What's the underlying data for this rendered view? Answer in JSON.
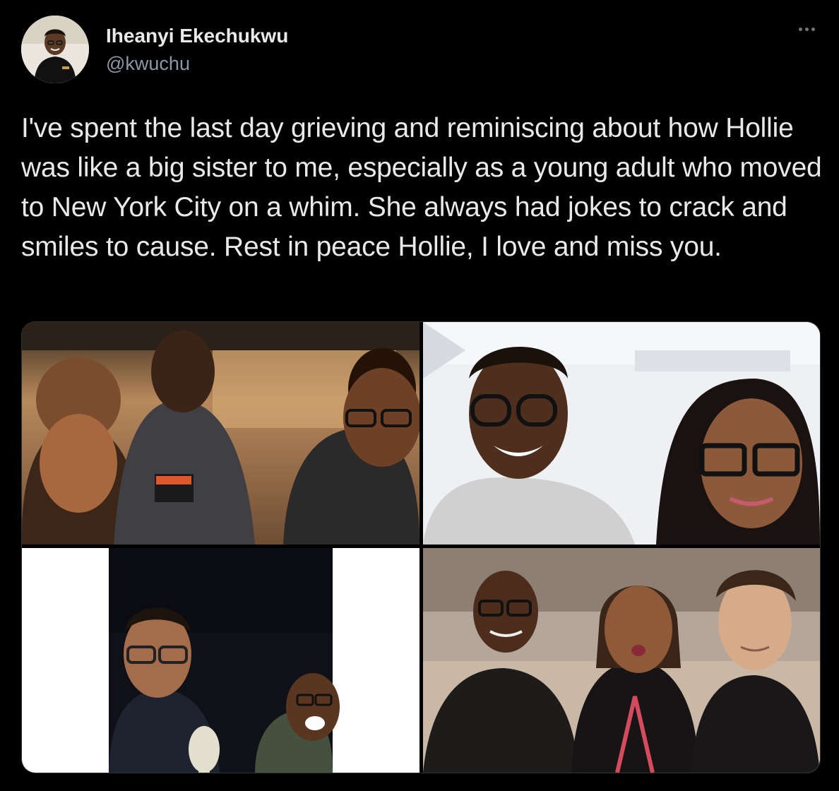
{
  "tweet": {
    "author": {
      "display_name": "Iheanyi Ekechukwu",
      "handle": "@kwuchu"
    },
    "more_icon": "ellipsis-icon",
    "text": "I've spent the last day grieving and reminiscing about how Hollie was like a big sister to me, especially as a young adult who moved to New York City on a whim. She always had jokes to crack and smiles to cause. Rest in peace Hollie, I love and miss you.",
    "media": {
      "count": 4
    }
  },
  "colors": {
    "background": "#000000",
    "text_primary": "#e7e9ea",
    "text_secondary": "#8b98a5"
  }
}
